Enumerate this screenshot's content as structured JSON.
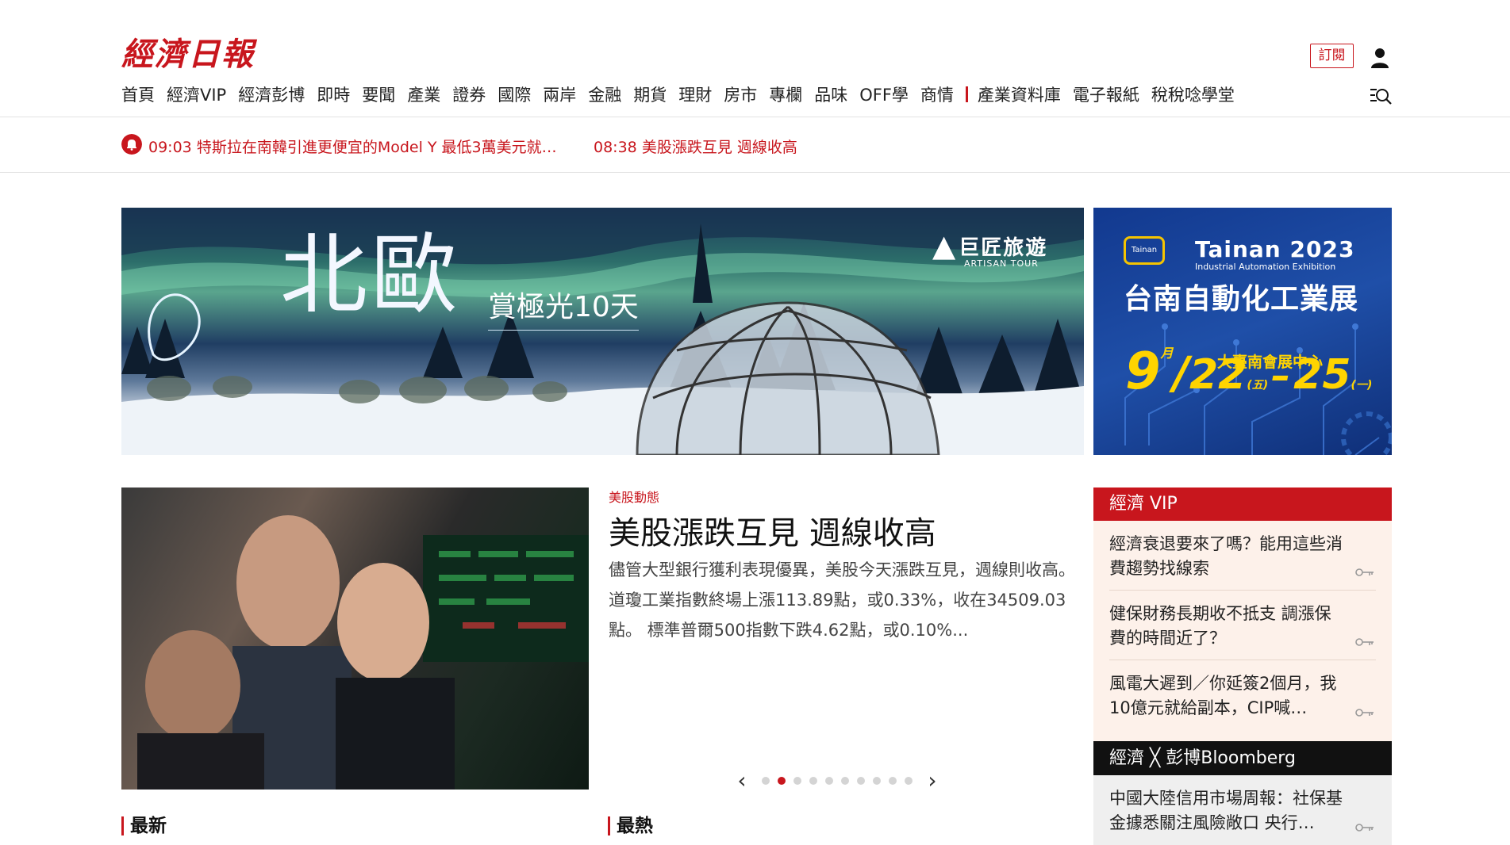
{
  "header": {
    "logo": "經濟日報",
    "subscribe_label": "訂閱",
    "nav": [
      "首頁",
      "經濟VIP",
      "經濟彭博",
      "即時",
      "要聞",
      "產業",
      "證券",
      "國際",
      "兩岸",
      "金融",
      "期貨",
      "理財",
      "房市",
      "專欄",
      "品味",
      "OFF學",
      "商情"
    ],
    "nav_extra": [
      "產業資料庫",
      "電子報紙",
      "稅稅唸學堂"
    ]
  },
  "ticker": {
    "items": [
      {
        "time": "09:03",
        "text": "特斯拉在南韓引進更便宜的Model Y 最低3萬美元就…"
      },
      {
        "time": "08:38",
        "text": "美股漲跌互見 週線收高"
      }
    ]
  },
  "banner_main": {
    "title": "北歐",
    "subtitle": "賞極光10天",
    "brand": "巨匠旅遊",
    "brand_en": "ARTISAN TOUR"
  },
  "banner_side": {
    "brand": "Tainan",
    "year_title": "Tainan 2023",
    "subtitle_en": "Industrial Automation Exhibition",
    "title": "台南自動化工業展",
    "venue": "大臺南會展中心",
    "month": "9",
    "month_unit": "月",
    "start_day": "22",
    "start_weekday": "(五)",
    "dash": "–",
    "end_day": "25",
    "end_weekday": "(一)"
  },
  "featured": {
    "tag": "美股動態",
    "title": "美股漲跌互見 週線收高",
    "summary": "儘管大型銀行獲利表現優異，美股今天漲跌互見，週線則收高。 道瓊工業指數終場上漲113.89點，或0.33%，收在34509.03點。 標準普爾500指數下跌4.62點，或0.10%..."
  },
  "carousel": {
    "prev": "‹",
    "next": "›",
    "total": 10,
    "active_index": 1
  },
  "sections": {
    "latest": "最新",
    "hot": "最熱"
  },
  "vip": {
    "heading": "經濟 VIP",
    "items": [
      "經濟衰退要來了嗎？能用這些消費趨勢找線索",
      "健保財務長期收不抵支 調漲保費的時間近了？",
      "風電大遲到／你延簽2個月，我10億元就給副本，CIP喊…"
    ]
  },
  "bloomberg": {
    "heading": "經濟 ╳ 彭博Bloomberg",
    "items": [
      "中國大陸信用市場周報：社保基金據悉關注風險敞口 央行…"
    ]
  },
  "colors": {
    "brand_red": "#c8161d",
    "vip_bg": "#fdf1ea",
    "bb_bg": "#efefef"
  }
}
